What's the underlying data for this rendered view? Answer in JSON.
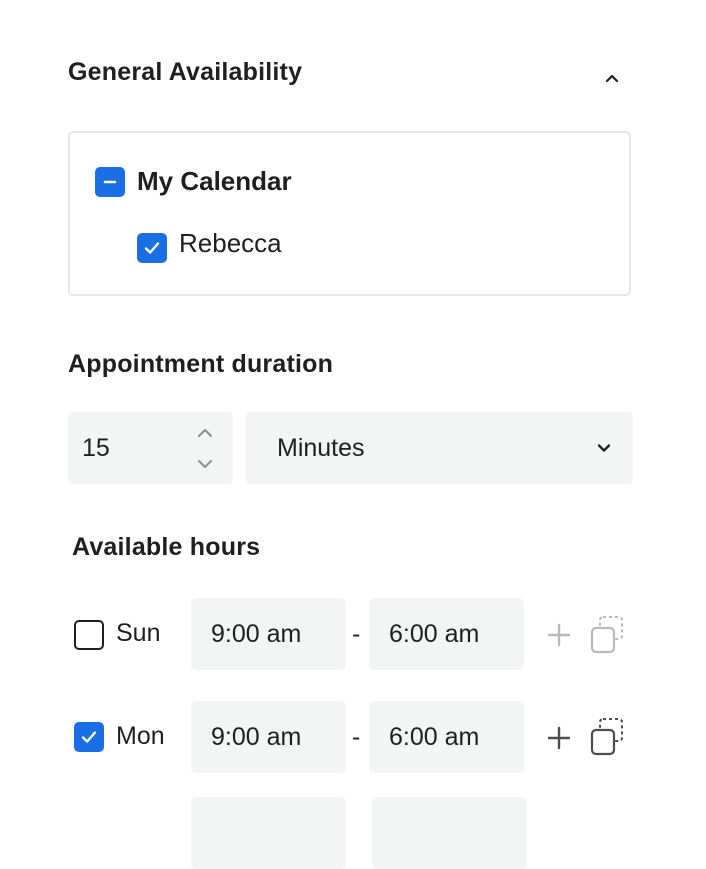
{
  "general": {
    "title": "General Availability",
    "calendar_group_label": "My Calendar",
    "calendar_items": [
      {
        "label": "Rebecca",
        "checked": true
      }
    ]
  },
  "duration": {
    "title": "Appointment duration",
    "value": "15",
    "unit": "Minutes"
  },
  "hours": {
    "title": "Available hours",
    "separator": "-",
    "days": [
      {
        "day": "Sun",
        "checked": false,
        "start": "9:00 am",
        "end": "6:00 am"
      },
      {
        "day": "Mon",
        "checked": true,
        "start": "9:00 am",
        "end": "6:00 am"
      }
    ]
  },
  "colors": {
    "accent": "#1a6fe6",
    "field_bg": "#f3f4f4",
    "border": "#e3e5e7"
  },
  "icons": {
    "collapse": "chevron-up-icon",
    "indeterminate": "minus-icon",
    "check": "check-icon",
    "increment": "chevron-up-icon",
    "decrement": "chevron-down-icon",
    "dropdown": "chevron-down-icon",
    "add": "plus-icon",
    "copy": "copy-icon"
  }
}
